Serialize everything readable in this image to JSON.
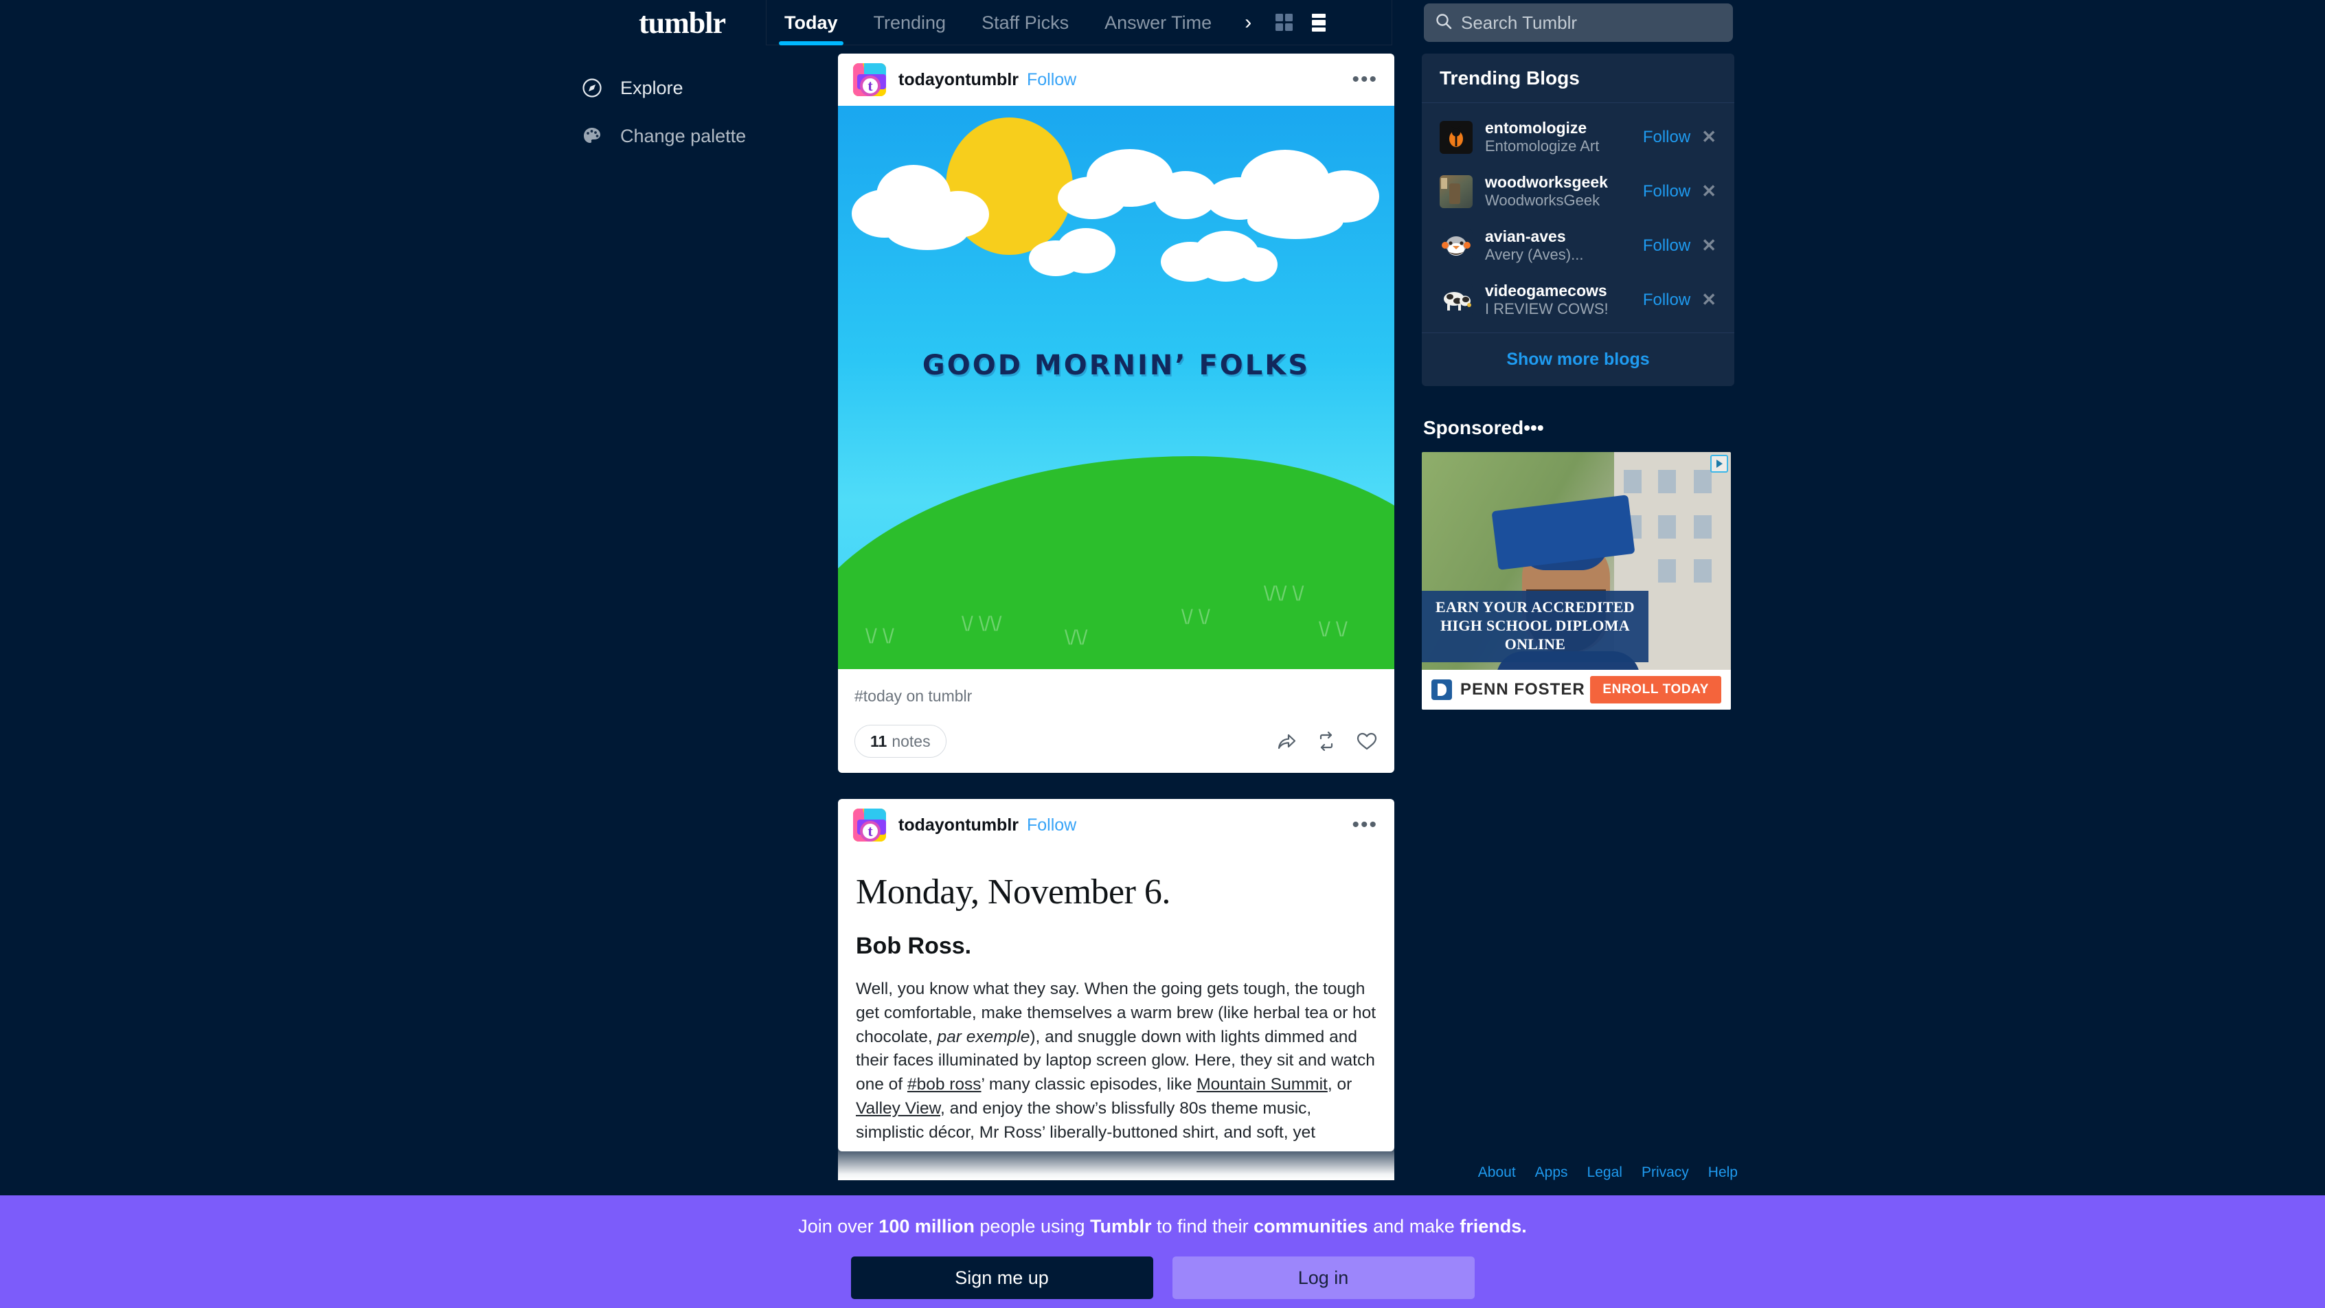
{
  "brand": {
    "logo": "tumblr",
    "accent": "#00b8ff",
    "bg": "#001935",
    "panel_bg": "#152a45",
    "banner_bg": "#7c5cfa"
  },
  "nav": {
    "tabs": [
      {
        "label": "Today",
        "active": true
      },
      {
        "label": "Trending",
        "active": false
      },
      {
        "label": "Staff Picks",
        "active": false
      },
      {
        "label": "Answer Time",
        "active": false
      }
    ],
    "more_chevron": "›",
    "grid_view_icon": "grid-view-icon",
    "list_view_icon": "list-view-icon"
  },
  "search": {
    "placeholder": "Search Tumblr",
    "value": "",
    "icon": "search-icon"
  },
  "sidebar": {
    "items": [
      {
        "label": "Explore",
        "icon": "compass-icon"
      },
      {
        "label": "Change palette",
        "icon": "palette-icon"
      }
    ]
  },
  "posts": [
    {
      "author": "todayontumblr",
      "follow_label": "Follow",
      "menu": "•••",
      "image_text": "GOOD MORNIN’ FOLKS",
      "tags": "#today on tumblr",
      "notes_count": "11",
      "notes_label": "notes",
      "actions": [
        "share-icon",
        "reblog-icon",
        "like-icon"
      ]
    },
    {
      "author": "todayontumblr",
      "follow_label": "Follow",
      "menu": "•••",
      "title": "Monday, November 6.",
      "subtitle": "Bob Ross.",
      "body_1": "Well, you know what they say. When the going gets tough, the tough get comfortable, make themselves a warm brew (like herbal tea or hot chocolate, ",
      "body_italic": "par exemple",
      "body_2": "), and snuggle down with lights dimmed and their faces illuminated by laptop screen glow. Here, they sit and watch one of ",
      "link_1": "#bob ross",
      "body_3": "’ many classic episodes, like ",
      "link_2": "Mountain Summit",
      "body_4": ", or ",
      "link_3": "Valley View",
      "body_5": ", and enjoy the show’s blissfully 80s theme music, simplistic décor, Mr Ross’ liberally-buttoned shirt, and soft, yet"
    }
  ],
  "trending": {
    "title": "Trending Blogs",
    "blogs": [
      {
        "name": "entomologize",
        "title": "Entomologize Art",
        "follow": "Follow",
        "dismiss": "✕",
        "avatar": "beetle-avatar"
      },
      {
        "name": "woodworksgeek",
        "title": "WoodworksGeek",
        "follow": "Follow",
        "dismiss": "✕",
        "avatar": "workshop-avatar"
      },
      {
        "name": "avian-aves",
        "title": "Avery (Aves)...",
        "follow": "Follow",
        "dismiss": "✕",
        "avatar": "bird-avatar"
      },
      {
        "name": "videogamecows",
        "title": "I REVIEW COWS!",
        "follow": "Follow",
        "dismiss": "✕",
        "avatar": "cow-avatar"
      }
    ],
    "show_more": "Show more blogs"
  },
  "sponsored": {
    "title": "Sponsored",
    "menu": "•••",
    "ad": {
      "headline_line1": "EARN YOUR ACCREDITED",
      "headline_line2": "HIGH SCHOOL DIPLOMA ONLINE",
      "brand": "PENN FOSTER",
      "cta": "ENROLL TODAY",
      "adchoices": "adchoices-icon"
    }
  },
  "footer_links": [
    "About",
    "Apps",
    "Legal",
    "Privacy",
    "Help"
  ],
  "banner": {
    "text_1": "Join over ",
    "bold_1": "100 million",
    "text_2": " people using ",
    "bold_2": "Tumblr",
    "text_3": " to find their ",
    "bold_3": "communities",
    "text_4": " and make ",
    "bold_4": "friends.",
    "signup": "Sign me up",
    "login": "Log in"
  }
}
